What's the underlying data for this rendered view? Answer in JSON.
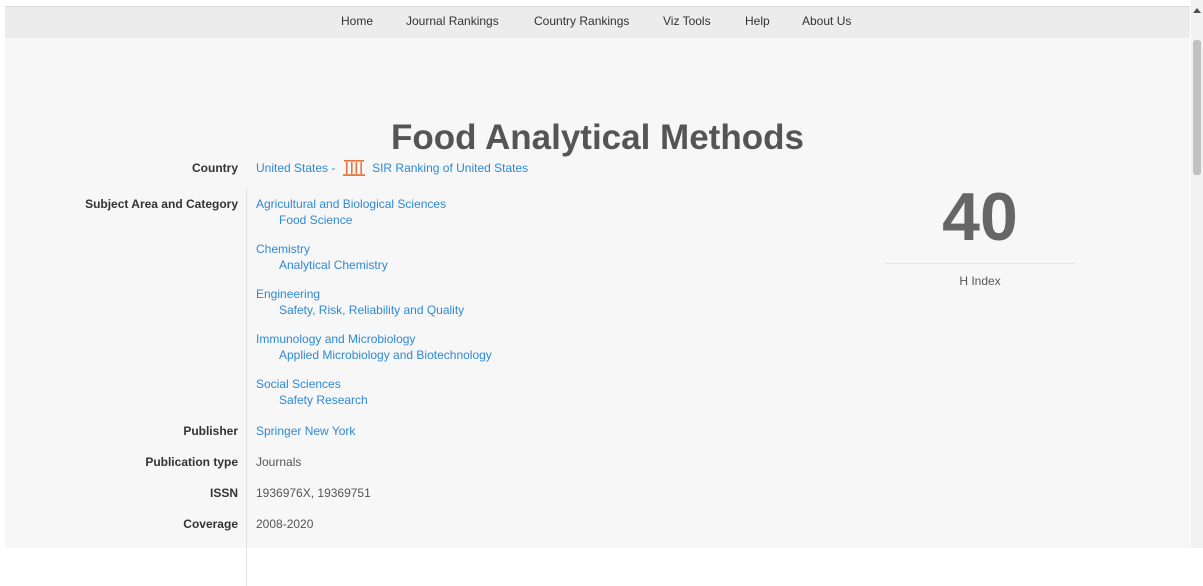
{
  "nav": {
    "items": [
      "Home",
      "Journal Rankings",
      "Country Rankings",
      "Viz Tools",
      "Help",
      "About Us"
    ]
  },
  "journal": {
    "title": "Food Analytical Methods"
  },
  "details": {
    "country_label": "Country",
    "country_value": "United States",
    "country_separator": "-",
    "sir_link": "SIR Ranking of United States",
    "subject_label": "Subject Area and Category",
    "subjects": [
      {
        "area": "Agricultural and Biological Sciences",
        "category": "Food Science"
      },
      {
        "area": "Chemistry",
        "category": "Analytical Chemistry"
      },
      {
        "area": "Engineering",
        "category": "Safety, Risk, Reliability and Quality"
      },
      {
        "area": "Immunology and Microbiology",
        "category": "Applied Microbiology and Biotechnology"
      },
      {
        "area": "Social Sciences",
        "category": "Safety Research"
      }
    ],
    "publisher_label": "Publisher",
    "publisher_value": "Springer New York",
    "pubtype_label": "Publication type",
    "pubtype_value": "Journals",
    "issn_label": "ISSN",
    "issn_value": "1936976X, 19369751",
    "coverage_label": "Coverage",
    "coverage_value": "2008-2020"
  },
  "hindex": {
    "value": "40",
    "label": "H Index"
  },
  "colors": {
    "link": "#2e89d6",
    "sir_icon": "#e8753d",
    "title": "#555555"
  }
}
